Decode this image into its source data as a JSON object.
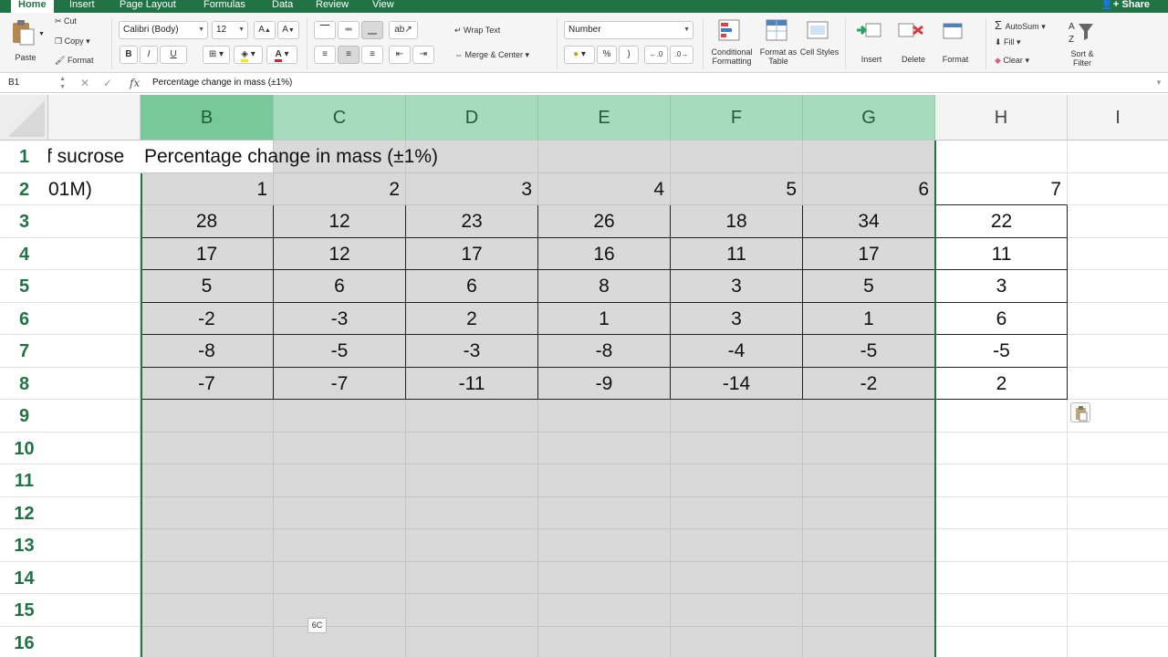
{
  "tabs": [
    "Home",
    "Insert",
    "Page Layout",
    "Formulas",
    "Data",
    "Review",
    "View"
  ],
  "share_label": "Share",
  "clipboard": {
    "paste": "Paste",
    "cut": "Cut",
    "copy": "Copy",
    "format": "Format"
  },
  "font": {
    "name": "Calibri (Body)",
    "size": "12",
    "bold": "B",
    "italic": "I",
    "underline": "U"
  },
  "alignment": {
    "wrap_text": "Wrap Text",
    "merge_center": "Merge & Center"
  },
  "number": {
    "format": "Number",
    "percent": "%",
    "comma": ")"
  },
  "styles": {
    "conditional": "Conditional Formatting",
    "format_table": "Format as Table",
    "cell_styles": "Cell Styles"
  },
  "cells": {
    "insert": "Insert",
    "delete": "Delete",
    "format": "Format"
  },
  "editing": {
    "autosum": "AutoSum",
    "fill": "Fill",
    "clear": "Clear",
    "sort_filter": "Sort & Filter"
  },
  "formula_bar": {
    "name_box": "B1",
    "fx": "fx",
    "content": "Percentage change in mass (±1%)"
  },
  "columns": [
    "B",
    "C",
    "D",
    "E",
    "F",
    "G",
    "H",
    "I"
  ],
  "rows": [
    "1",
    "2",
    "3",
    "4",
    "5",
    "6",
    "7",
    "8",
    "9",
    "10",
    "11",
    "12",
    "13",
    "14",
    "15",
    "16"
  ],
  "sheet": {
    "a1_partial": "f sucrose",
    "a2_partial": "01M)",
    "b1": "Percentage change in mass (±1%)",
    "trial_numbers": [
      "1",
      "2",
      "3",
      "4",
      "5",
      "6",
      "7"
    ],
    "data": [
      [
        "28",
        "12",
        "23",
        "26",
        "18",
        "34",
        "22"
      ],
      [
        "17",
        "12",
        "17",
        "16",
        "11",
        "17",
        "11"
      ],
      [
        "5",
        "6",
        "6",
        "8",
        "3",
        "5",
        "3"
      ],
      [
        "-2",
        "-3",
        "2",
        "1",
        "3",
        "1",
        "6"
      ],
      [
        "-8",
        "-5",
        "-3",
        "-8",
        "-4",
        "-5",
        "-5"
      ],
      [
        "-7",
        "-7",
        "-11",
        "-9",
        "-14",
        "-2",
        "2"
      ]
    ]
  },
  "tooltip": "6C"
}
